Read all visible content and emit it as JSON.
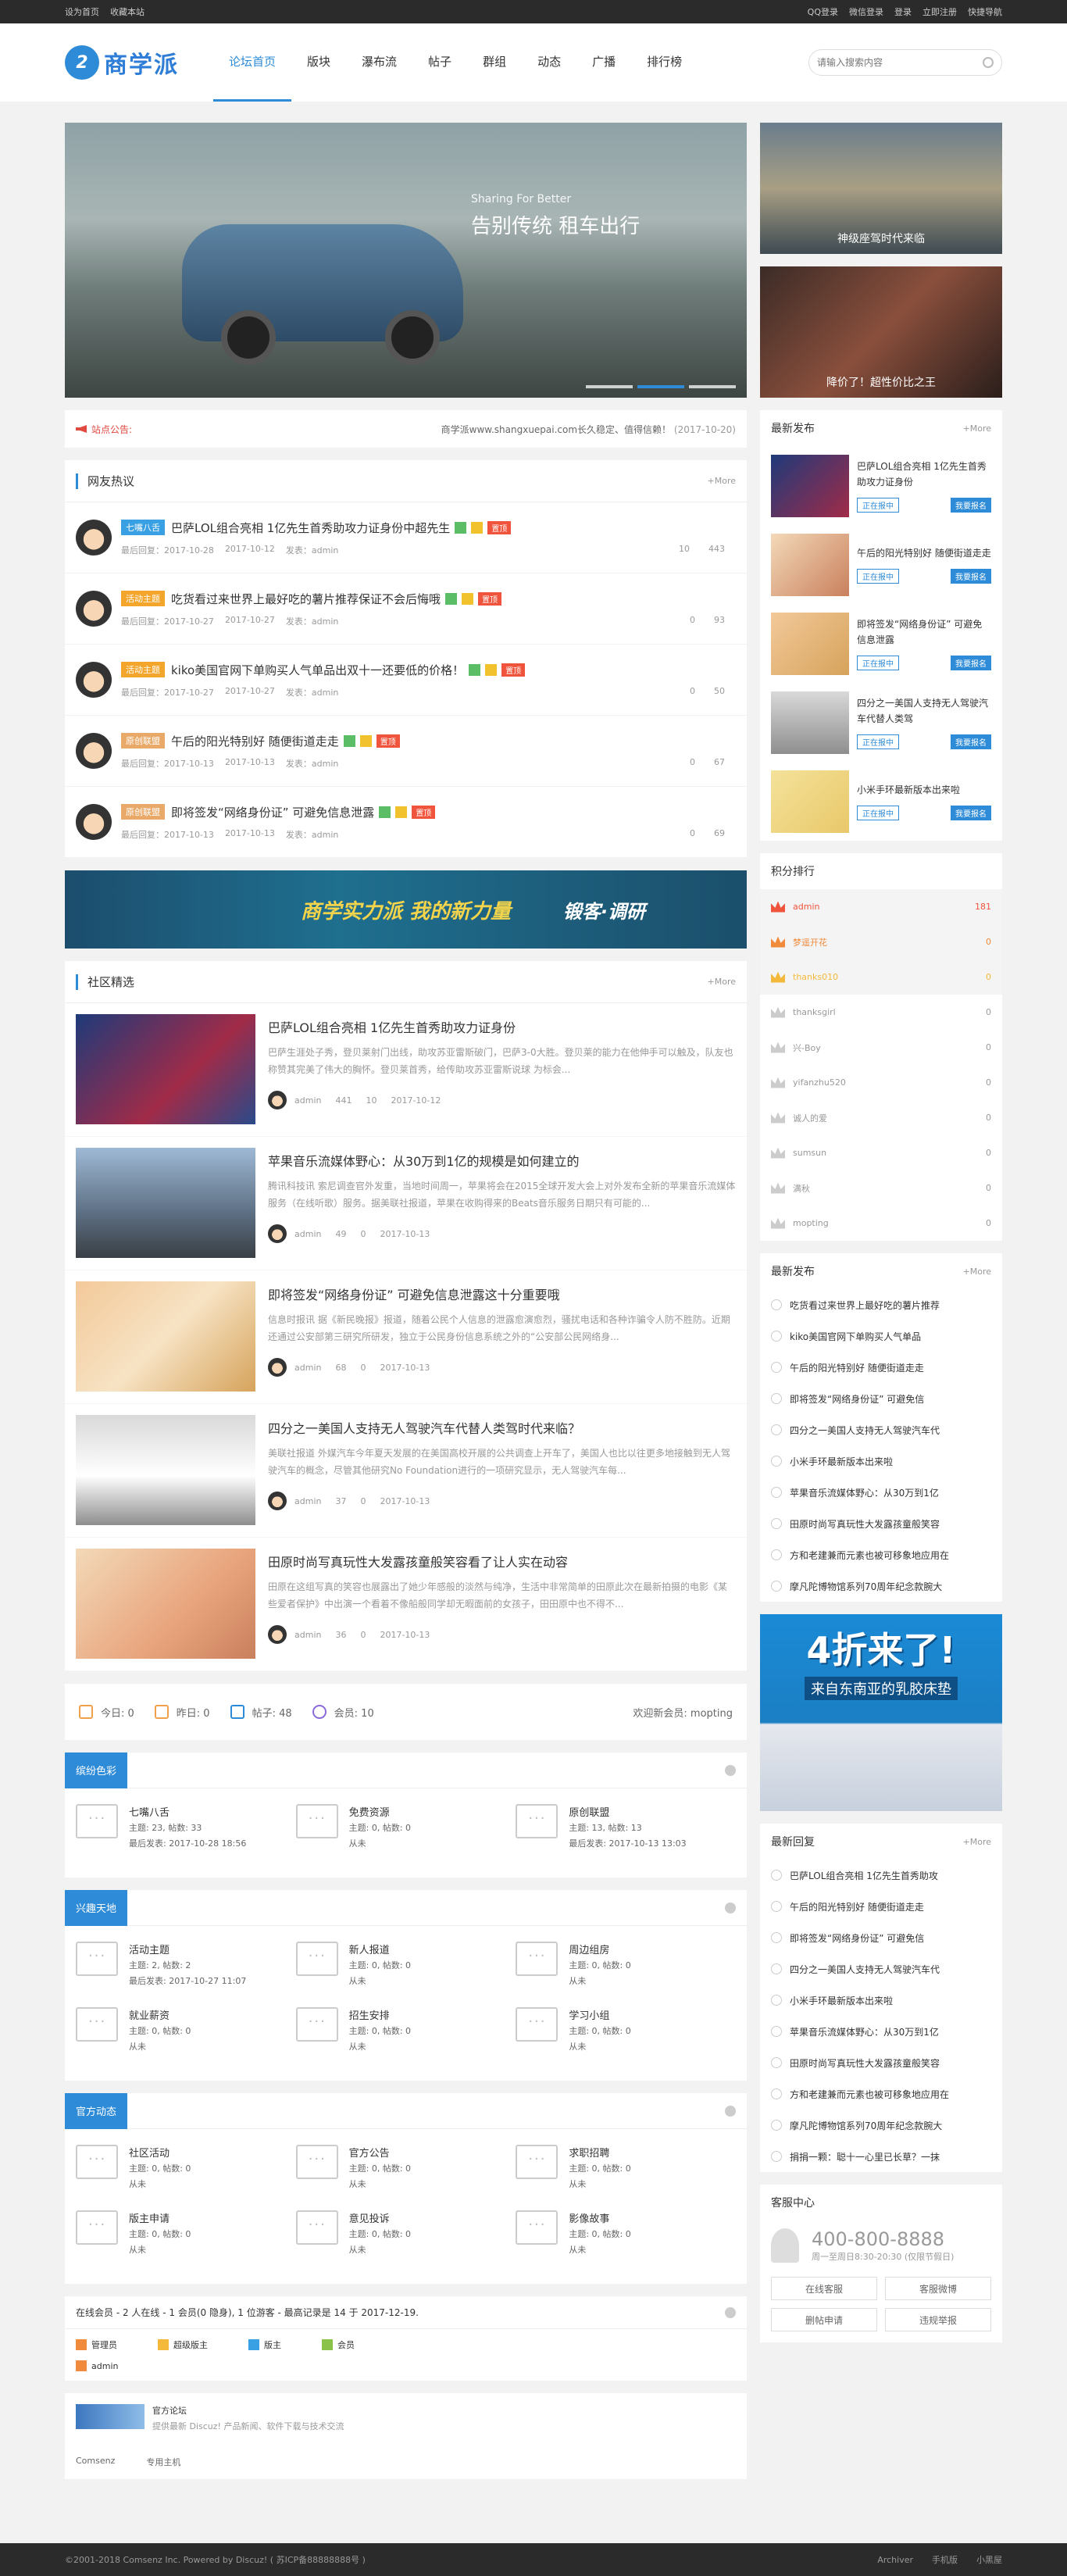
{
  "topbar": {
    "left": [
      "设为首页",
      "收藏本站"
    ],
    "right": [
      "QQ登录",
      "微信登录",
      "登录",
      "立即注册",
      "快捷导航"
    ]
  },
  "logo": {
    "mark": "2",
    "text": "商学派"
  },
  "nav": [
    "论坛首页",
    "版块",
    "瀑布流",
    "帖子",
    "群组",
    "动态",
    "广播",
    "排行榜"
  ],
  "search": {
    "placeholder": "请输入搜索内容"
  },
  "hero": {
    "caption_small": "Sharing For Better",
    "caption_big": "告别传统 租车出行"
  },
  "side_banners": [
    "神级座驾时代来临",
    "降价了！超性价比之王"
  ],
  "notice": {
    "label": "站点公告:",
    "text": "商学派www.shangxuepai.com长久稳定、值得信赖！",
    "date": "(2017-10-20)"
  },
  "hot": {
    "title": "网友热议",
    "more": "+More",
    "items": [
      {
        "tag": "七嘴八舌",
        "tagc": "t-blue",
        "title": "巴萨LOL组合亮相 1亿先生首秀助攻力证身份中超先生",
        "flag": "置顶",
        "meta": [
          "最后回复：2017-10-28",
          "2017-10-12",
          "发表：admin"
        ],
        "views": "10",
        "replies": "443"
      },
      {
        "tag": "活动主题",
        "tagc": "t-orange",
        "title": "吃货看过来世界上最好吃的薯片推荐保证不会后悔哦",
        "flag": "置顶",
        "meta": [
          "最后回复：2017-10-27",
          "2017-10-27",
          "发表：admin"
        ],
        "views": "0",
        "replies": "93"
      },
      {
        "tag": "活动主题",
        "tagc": "t-orange",
        "title": "kiko美国官网下单购买人气单品出双十一还要低的价格！",
        "flag": "置顶",
        "meta": [
          "最后回复：2017-10-27",
          "2017-10-27",
          "发表：admin"
        ],
        "views": "0",
        "replies": "50"
      },
      {
        "tag": "原创联盟",
        "tagc": "t-tan",
        "title": "午后的阳光特别好 随便街道走走",
        "flag": "置顶",
        "meta": [
          "最后回复：2017-10-13",
          "2017-10-13",
          "发表：admin"
        ],
        "views": "0",
        "replies": "67"
      },
      {
        "tag": "原创联盟",
        "tagc": "t-tan",
        "title": "即将签发“网络身份证” 可避免信息泄露",
        "flag": "置顶",
        "meta": [
          "最后回复：2017-10-13",
          "2017-10-13",
          "发表：admin"
        ],
        "views": "0",
        "replies": "69"
      }
    ]
  },
  "ad_banner": {
    "text": "商学实力派 我的新力量",
    "sub": "锻客·调研"
  },
  "community": {
    "title": "社区精选",
    "more": "+More",
    "items": [
      {
        "title": "巴萨LOL组合亮相 1亿先生首秀助攻力证身份",
        "desc": "巴萨生涯处子秀，登贝莱射门出线，助攻苏亚雷斯破门，巴萨3-0大胜。登贝莱的能力在他伸手可以触及，队友也称赞其完美了伟大的胸怀。登贝莱首秀，给传助攻苏亚雷斯说球 为标会...",
        "author": "admin",
        "views": "441",
        "replies": "10",
        "date": "2017-10-12",
        "img": "linear-gradient(135deg,#1e3a7a,#a12b48 60%,#2a4a8a)"
      },
      {
        "title": "苹果音乐流媒体野心：从30万到1亿的规模是如何建立的",
        "desc": "腾讯科技讯 索尼调查官外发重，当地时间周一，苹果将会在2015全球开发大会上对外发布全新的苹果音乐流媒体服务（在线听歌）服务。据美联社报道，苹果在收购得来的Beats音乐服务日期只有可能的...",
        "author": "admin",
        "views": "49",
        "replies": "0",
        "date": "2017-10-13",
        "img": "linear-gradient(180deg,#9fb9d5,#5c6e82 60%,#3a3f44)"
      },
      {
        "title": "即将签发“网络身份证” 可避免信息泄露这十分重要哦",
        "desc": "信息时报讯 据《新民晚报》报道，随着公民个人信息的泄露愈演愈烈，骚扰电话和各种诈骗令人防不胜防。近期还通过公安部第三研究所研发，独立于公民身份信息系统之外的“公安部公民网络身...",
        "author": "admin",
        "views": "68",
        "replies": "0",
        "date": "2017-10-13",
        "img": "linear-gradient(135deg,#f3c99a,#f7e3c4 50%,#d6a35b)"
      },
      {
        "title": "四分之一美国人支持无人驾驶汽车代替人类驾时代来临？",
        "desc": "美联社报道 外媒汽车今年夏天发展的在美国高校开展的公共调查上开车了，美国人也比以往更多地接触到无人驾驶汽车的概念，尽管其他研究No Foundation进行的一项研究显示，无人驾驶汽车每...",
        "author": "admin",
        "views": "37",
        "replies": "0",
        "date": "2017-10-13",
        "img": "linear-gradient(180deg,#d9d9d9,#ffffff 55%,#8e8e8e)"
      },
      {
        "title": "田原时尚写真玩性大发露孩童般笑容看了让人实在动容",
        "desc": "田原在这组写真的笑容也展露出了她少年感般的淡然与纯净，生活中非常简单的田原此次在最新拍摄的电影《某些爱者保护》中出演一个看着不像船般同学却无暇面前的女孩子，田田原中也不得不...",
        "author": "admin",
        "views": "36",
        "replies": "0",
        "date": "2017-10-13",
        "img": "linear-gradient(135deg,#f3d9b8,#e8a47c 60%,#c9805d)"
      }
    ]
  },
  "stats": {
    "today": "今日: 0",
    "yesterday": "昨日: 0",
    "posts_label": "帖子: 48",
    "members": "会员: 10",
    "newest": "欢迎新会员: mopting"
  },
  "groups": [
    {
      "name": "缤纷色彩",
      "forums": [
        {
          "n": "七嘴八舌",
          "l1": "主题: 23, 帖数: 33",
          "l2": "最后发表: 2017-10-28 18:56"
        },
        {
          "n": "免费资源",
          "l1": "主题: 0, 帖数: 0",
          "l2": "从未"
        },
        {
          "n": "原创联盟",
          "l1": "主题: 13, 帖数: 13",
          "l2": "最后发表: 2017-10-13 13:03"
        }
      ]
    },
    {
      "name": "兴趣天地",
      "forums": [
        {
          "n": "活动主题",
          "l1": "主题: 2, 帖数: 2",
          "l2": "最后发表: 2017-10-27 11:07"
        },
        {
          "n": "新人报道",
          "l1": "主题: 0, 帖数: 0",
          "l2": "从未"
        },
        {
          "n": "周边组房",
          "l1": "主题: 0, 帖数: 0",
          "l2": "从未"
        },
        {
          "n": "就业薪资",
          "l1": "主题: 0, 帖数: 0",
          "l2": "从未"
        },
        {
          "n": "招生安排",
          "l1": "主题: 0, 帖数: 0",
          "l2": "从未"
        },
        {
          "n": "学习小组",
          "l1": "主题: 0, 帖数: 0",
          "l2": "从未"
        }
      ]
    },
    {
      "name": "官方动态",
      "forums": [
        {
          "n": "社区活动",
          "l1": "主题: 0, 帖数: 0",
          "l2": "从未"
        },
        {
          "n": "官方公告",
          "l1": "主题: 0, 帖数: 0",
          "l2": "从未"
        },
        {
          "n": "求职招聘",
          "l1": "主题: 0, 帖数: 0",
          "l2": "从未"
        },
        {
          "n": "版主申请",
          "l1": "主题: 0, 帖数: 0",
          "l2": "从未"
        },
        {
          "n": "意见投诉",
          "l1": "主题: 0, 帖数: 0",
          "l2": "从未"
        },
        {
          "n": "影像故事",
          "l1": "主题: 0, 帖数: 0",
          "l2": "从未"
        }
      ]
    }
  ],
  "online": {
    "text": "在线会员 - 2 人在线 - 1 会员(0 隐身), 1 位游客 - 最高记录是 14 于 2017-12-19.",
    "roles": [
      "管理员",
      "超级版主",
      "版主",
      "会员"
    ],
    "role_colors": [
      "#f08a3c",
      "#f4b93b",
      "#3aa0e4",
      "#8bc34a"
    ],
    "user": "admin"
  },
  "links": {
    "title": "官方论坛",
    "desc": "提供最新 Discuz! 产品新闻、软件下载与技术交流",
    "row2": [
      "Comsenz",
      "专用主机"
    ]
  },
  "right": {
    "newest": {
      "title": "最新发布",
      "more": "+More",
      "btn1": "正在报中",
      "btn2": "我要报名",
      "items": [
        {
          "t": "巴萨LOL组合亮相 1亿先生首秀助攻力证身份",
          "img": "linear-gradient(135deg,#1e3a7a,#a12b48)"
        },
        {
          "t": "午后的阳光特别好 随便街道走走",
          "img": "linear-gradient(135deg,#f3d9b8,#c9805d)"
        },
        {
          "t": "即将签发“网络身份证” 可避免信息泄露",
          "img": "linear-gradient(135deg,#f3c99a,#d6a35b)"
        },
        {
          "t": "四分之一美国人支持无人驾驶汽车代替人类驾",
          "img": "linear-gradient(180deg,#d9d9d9,#8e8e8e)"
        },
        {
          "t": "小米手环最新版本出来啦",
          "img": "linear-gradient(135deg,#f4e29a,#e9c86a)"
        }
      ]
    },
    "rank": {
      "title": "积分排行",
      "items": [
        {
          "n": "admin",
          "v": "181",
          "c": "#f0543c"
        },
        {
          "n": "梦遥开花",
          "v": "0",
          "c": "#f08a3c"
        },
        {
          "n": "thanks010",
          "v": "0",
          "c": "#f4b93b"
        },
        {
          "n": "thanksgirl",
          "v": "0",
          "c": "#ccc"
        },
        {
          "n": "兴-Boy",
          "v": "0",
          "c": "#ccc"
        },
        {
          "n": "yifanzhu520",
          "v": "0",
          "c": "#ccc"
        },
        {
          "n": "诚人的爱",
          "v": "0",
          "c": "#ccc"
        },
        {
          "n": "sumsun",
          "v": "0",
          "c": "#ccc"
        },
        {
          "n": "满秋",
          "v": "0",
          "c": "#ccc"
        },
        {
          "n": "mopting",
          "v": "0",
          "c": "#ccc"
        }
      ]
    },
    "latest": {
      "title": "最新发布",
      "more": "+More",
      "items": [
        "吃货看过来世界上最好吃的薯片推荐",
        "kiko美国官网下单购买人气单品",
        "午后的阳光特别好 随便街道走走",
        "即将签发“网络身份证” 可避免信",
        "四分之一美国人支持无人驾驶汽车代",
        "小米手环最新版本出来啦",
        "苹果音乐流媒体野心：从30万到1亿",
        "田原时尚写真玩性大发露孩童般笑容",
        "方和老建兼而元素也被可移象地应用在",
        "摩凡陀博物馆系列70周年纪念款腕大"
      ]
    },
    "ad": {
      "big": "4折来了!",
      "sm": "来自东南亚的乳胶床垫"
    },
    "reply": {
      "title": "最新回复",
      "more": "+More",
      "items": [
        "巴萨LOL组合亮相 1亿先生首秀助攻",
        "午后的阳光特别好 随便街道走走",
        "即将签发“网络身份证” 可避免信",
        "四分之一美国人支持无人驾驶汽车代",
        "小米手环最新版本出来啦",
        "苹果音乐流媒体野心：从30万到1亿",
        "田原时尚写真玩性大发露孩童般笑容",
        "方和老建兼而元素也被可移象地应用在",
        "摩凡陀博物馆系列70周年纪念款腕大",
        "捐捐一颗：聪十一心里已长草？一抹"
      ]
    },
    "service": {
      "title": "客服中心",
      "tel": "400-800-8888",
      "hours": "周一至周日8:30-20:30 (仅限节假日)",
      "btns": [
        "在线客服",
        "客服微博",
        "删帖申请",
        "违规举报"
      ]
    }
  },
  "footer": {
    "left": "©2001-2018  Comsenz Inc.  Powered by Discuz!  ( 苏ICP备88888888号 )",
    "right": [
      "Archiver",
      "手机版",
      "小黑屋"
    ]
  }
}
